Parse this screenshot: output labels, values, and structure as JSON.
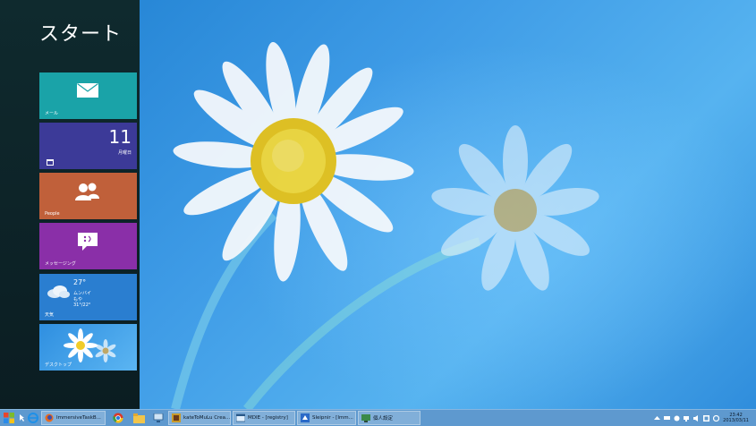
{
  "start": {
    "title": "スタート",
    "tiles": {
      "mail": {
        "label": "メール",
        "icon": "mail-icon"
      },
      "calendar": {
        "day": "11",
        "weekday": "月曜日",
        "icon": "calendar-icon"
      },
      "people": {
        "label": "People",
        "icon": "people-icon"
      },
      "messaging": {
        "label": "メッセージング",
        "icon": "messaging-icon"
      },
      "weather": {
        "temp": "27°",
        "city": "ムンバイ",
        "condition": "もや",
        "range": "31°/22°",
        "label": "天気",
        "icon": "cloud-icon"
      },
      "desktop": {
        "label": "デスクトップ"
      }
    }
  },
  "taskbar": {
    "buttons": [
      {
        "label": "ImmersiveTaskB..."
      },
      {
        "label": "kateToMuLu Crea..."
      },
      {
        "label": "MDIE - [registry]"
      },
      {
        "label": "Sleipnir - [Imm..."
      },
      {
        "label": "個人設定"
      }
    ],
    "clock": {
      "time": "23:42",
      "date": "2013/03/11"
    }
  },
  "colors": {
    "mail": "#1aa3a8",
    "calendar": "#3c3a98",
    "people": "#c0603a",
    "messaging": "#8a2fa8",
    "weather": "#2a7ed0",
    "taskbar": "#5e99cf"
  }
}
